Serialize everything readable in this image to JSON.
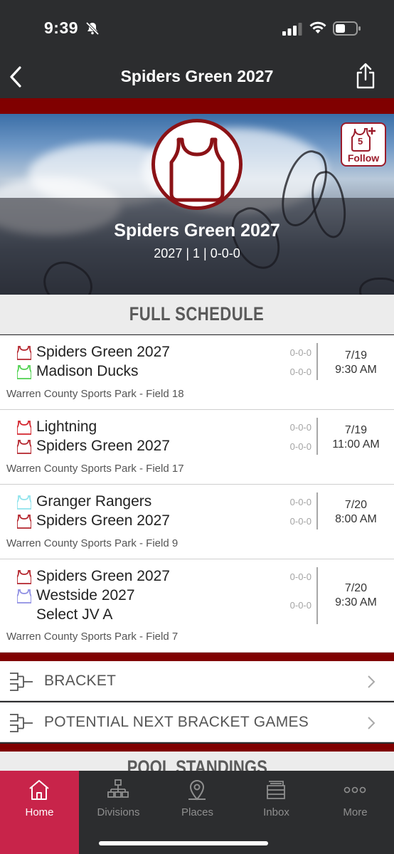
{
  "status_bar": {
    "time": "9:39"
  },
  "nav": {
    "title": "Spiders Green 2027"
  },
  "hero": {
    "team_name": "Spiders Green 2027",
    "subtitle": "2027 | 1 | 0-0-0",
    "follow_count": "5",
    "follow_label": "Follow"
  },
  "schedule": {
    "header": "FULL SCHEDULE",
    "games": [
      {
        "teams": [
          {
            "name": "Spiders Green 2027",
            "record": "0-0-0",
            "jersey_color": "#b4242c"
          },
          {
            "name": "Madison Ducks",
            "record": "0-0-0",
            "jersey_color": "#4fd14f"
          }
        ],
        "date": "7/19",
        "time": "9:30 AM",
        "venue": "Warren County Sports Park - Field 18"
      },
      {
        "teams": [
          {
            "name": "Lightning",
            "record": "0-0-0",
            "jersey_color": "#d4242c"
          },
          {
            "name": "Spiders Green 2027",
            "record": "0-0-0",
            "jersey_color": "#b4242c"
          }
        ],
        "date": "7/19",
        "time": "11:00 AM",
        "venue": "Warren County Sports Park - Field 17"
      },
      {
        "teams": [
          {
            "name": "Granger Rangers",
            "record": "0-0-0",
            "jersey_color": "#8fe3ec"
          },
          {
            "name": "Spiders Green 2027",
            "record": "0-0-0",
            "jersey_color": "#b4242c"
          }
        ],
        "date": "7/20",
        "time": "8:00 AM",
        "venue": "Warren County Sports Park - Field 9"
      },
      {
        "teams": [
          {
            "name": "Spiders Green 2027",
            "record": "0-0-0",
            "jersey_color": "#b4242c"
          },
          {
            "name_line1": "Westside 2027",
            "name_line2": "Select JV A",
            "record": "0-0-0",
            "jersey_color": "#8f8fe3"
          }
        ],
        "date": "7/20",
        "time": "9:30 AM",
        "venue": "Warren County Sports Park - Field 7"
      }
    ]
  },
  "links": {
    "bracket": "BRACKET",
    "potential": "POTENTIAL NEXT BRACKET GAMES"
  },
  "pool_standings": "POOL STANDINGS",
  "tabs": [
    {
      "label": "Home",
      "icon": "home-icon",
      "active": true
    },
    {
      "label": "Divisions",
      "icon": "divisions-icon"
    },
    {
      "label": "Places",
      "icon": "map-pin-icon"
    },
    {
      "label": "Inbox",
      "icon": "inbox-icon"
    },
    {
      "label": "More",
      "icon": "more-icon"
    }
  ],
  "colors": {
    "brand": "#800000",
    "accent_tab": "#c8244a",
    "bar": "#2c2d2f"
  }
}
